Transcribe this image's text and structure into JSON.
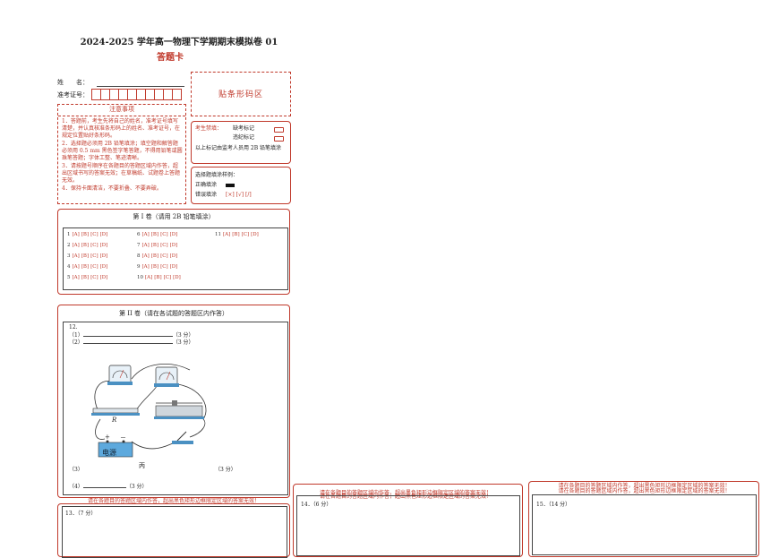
{
  "header": {
    "title": "2024-2025 学年高一物理下学期期末模拟卷 01",
    "subtitle": "答题卡"
  },
  "student": {
    "name_label": "姓　　名：",
    "id_label": "准考证号："
  },
  "barcode_label": "贴条形码区",
  "notes": {
    "title": "注意事项",
    "items": [
      "1．答题前，考生先将自己的姓名，准考证号填写清楚，并认真核准条形码上的姓名、准考证号，在规定位置贴好条形码。",
      "2．选择题必须用 2B 铅笔填涂；填空题和解答题必须用 0.5 mm 黑色签字笔答题，不得用铅笔或圆珠笔答题；字体工整、笔迹清晰。",
      "3．请按题号顺序在各题目的答题区域内作答，超出区域书写的答案无效；在草稿纸、试题卷上答题无效。",
      "4．保持卡面清洁，不要折叠、不要弄破。"
    ]
  },
  "candidate_status": {
    "label": "考生禁填：",
    "absent": "缺考标记",
    "violation": "违纪标记",
    "note": "以上标记由监考人员用 2B 铅笔填涂"
  },
  "fill_sample": {
    "title": "选择题填涂样例：",
    "correct": "正确填涂",
    "wrong": "错误填涂",
    "wrong_marks": "[×]  [√]  [/]"
  },
  "section1": {
    "title": "第 I 卷（请用 2B 铅笔填涂）",
    "options": [
      "[A]",
      "[B]",
      "[C]",
      "[D]"
    ],
    "questions": [
      "1",
      "2",
      "3",
      "4",
      "5",
      "6",
      "7",
      "8",
      "9",
      "10",
      "11"
    ]
  },
  "section2": {
    "title": "第 II 卷（请在各试题的答题区内作答）",
    "q12": {
      "num": "12.",
      "p1": "（1）",
      "p2": "（2）",
      "score": "（3 分）",
      "p3": "（3）",
      "p4": "（4）",
      "figure_caption": "丙",
      "R_label": "R",
      "plus": "+",
      "minus": "－",
      "source_label": "电源"
    }
  },
  "warning": "请在各题目的答题区域内作答，超出黑色矩形边框限定区域的答案无效！",
  "q13": "13．（7 分）",
  "q14": "14．（6 分）",
  "q15": "15．（14 分）"
}
